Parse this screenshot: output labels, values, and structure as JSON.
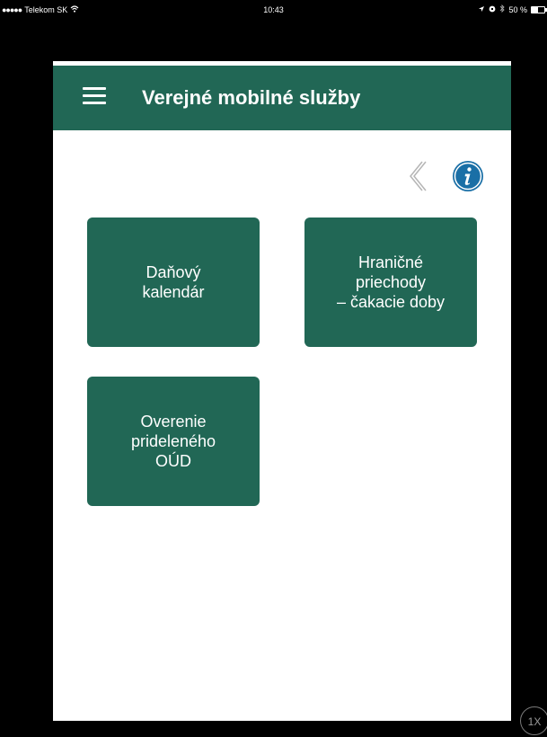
{
  "status_bar": {
    "carrier": "Telekom SK",
    "time": "10:43",
    "battery_percent": "50 %",
    "battery_level": 0.5,
    "icons": [
      "signal-dots-icon",
      "wifi-icon",
      "location-arrow-icon",
      "lock-rotation-icon",
      "bluetooth-icon",
      "battery-icon"
    ]
  },
  "header": {
    "title": "Verejné mobilné služby",
    "menu_icon": "hamburger-menu-icon",
    "background_color": "#216755"
  },
  "toolbar": {
    "back_icon": "chevron-left-icon",
    "info_icon": "info-icon",
    "info_color": "#1a6fa6"
  },
  "tiles": [
    {
      "label": "Daňový\nkalendár"
    },
    {
      "label": "Hraničné\npriechody\n– čakacie doby"
    },
    {
      "label": "Overenie\nprideleného\nOÚD"
    }
  ],
  "zoom_badge": {
    "label": "1X"
  }
}
